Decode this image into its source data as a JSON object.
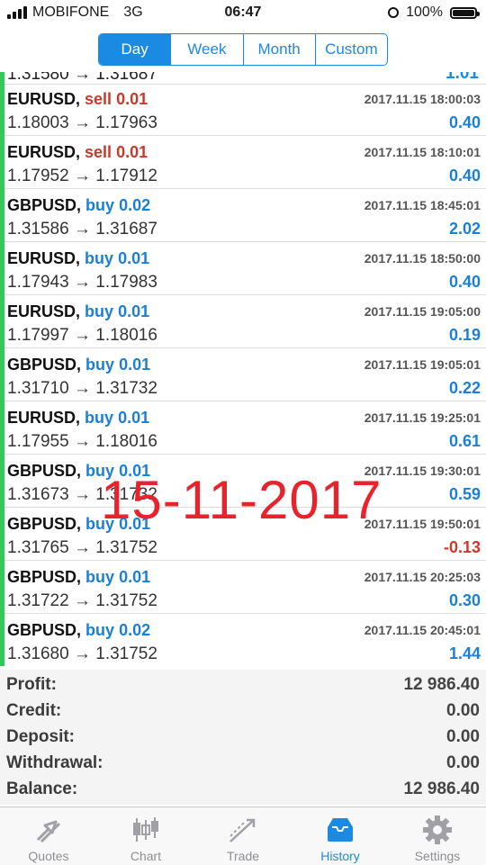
{
  "status_bar": {
    "carrier": "MOBIFONE",
    "network": "3G",
    "time": "06:47",
    "battery": "100%"
  },
  "period_tabs": [
    {
      "label": "Day",
      "active": true
    },
    {
      "label": "Week",
      "active": false
    },
    {
      "label": "Month",
      "active": false
    },
    {
      "label": "Custom",
      "active": false
    }
  ],
  "partial_row": {
    "left": "1.31580 → 1.31687",
    "right": "1.01"
  },
  "trades": [
    {
      "symbol": "EURUSD,",
      "side": "sell",
      "volume": "0.01",
      "time": "2017.11.15 18:00:03",
      "open": "1.18003",
      "close": "1.17963",
      "profit": "0.40"
    },
    {
      "symbol": "EURUSD,",
      "side": "sell",
      "volume": "0.01",
      "time": "2017.11.15 18:10:01",
      "open": "1.17952",
      "close": "1.17912",
      "profit": "0.40"
    },
    {
      "symbol": "GBPUSD,",
      "side": "buy",
      "volume": "0.02",
      "time": "2017.11.15 18:45:01",
      "open": "1.31586",
      "close": "1.31687",
      "profit": "2.02"
    },
    {
      "symbol": "EURUSD,",
      "side": "buy",
      "volume": "0.01",
      "time": "2017.11.15 18:50:00",
      "open": "1.17943",
      "close": "1.17983",
      "profit": "0.40"
    },
    {
      "symbol": "EURUSD,",
      "side": "buy",
      "volume": "0.01",
      "time": "2017.11.15 19:05:00",
      "open": "1.17997",
      "close": "1.18016",
      "profit": "0.19"
    },
    {
      "symbol": "GBPUSD,",
      "side": "buy",
      "volume": "0.01",
      "time": "2017.11.15 19:05:01",
      "open": "1.31710",
      "close": "1.31732",
      "profit": "0.22"
    },
    {
      "symbol": "EURUSD,",
      "side": "buy",
      "volume": "0.01",
      "time": "2017.11.15 19:25:01",
      "open": "1.17955",
      "close": "1.18016",
      "profit": "0.61"
    },
    {
      "symbol": "GBPUSD,",
      "side": "buy",
      "volume": "0.01",
      "time": "2017.11.15 19:30:01",
      "open": "1.31673",
      "close": "1.31732",
      "profit": "0.59"
    },
    {
      "symbol": "GBPUSD,",
      "side": "buy",
      "volume": "0.01",
      "time": "2017.11.15 19:50:01",
      "open": "1.31765",
      "close": "1.31752",
      "profit": "-0.13"
    },
    {
      "symbol": "GBPUSD,",
      "side": "buy",
      "volume": "0.01",
      "time": "2017.11.15 20:25:03",
      "open": "1.31722",
      "close": "1.31752",
      "profit": "0.30"
    },
    {
      "symbol": "GBPUSD,",
      "side": "buy",
      "volume": "0.02",
      "time": "2017.11.15 20:45:01",
      "open": "1.31680",
      "close": "1.31752",
      "profit": "1.44"
    }
  ],
  "watermark": "15-11-2017",
  "summary": [
    {
      "label": "Profit:",
      "value": "12 986.40"
    },
    {
      "label": "Credit:",
      "value": "0.00"
    },
    {
      "label": "Deposit:",
      "value": "0.00"
    },
    {
      "label": "Withdrawal:",
      "value": "0.00"
    },
    {
      "label": "Balance:",
      "value": "12 986.40"
    }
  ],
  "tab_bar": [
    {
      "label": "Quotes",
      "icon": "quotes-icon",
      "active": false
    },
    {
      "label": "Chart",
      "icon": "chart-icon",
      "active": false
    },
    {
      "label": "Trade",
      "icon": "trade-icon",
      "active": false
    },
    {
      "label": "History",
      "icon": "history-icon",
      "active": true
    },
    {
      "label": "Settings",
      "icon": "settings-icon",
      "active": false
    }
  ],
  "colors": {
    "accent": "#1b8ae3",
    "sell": "#c83a2a",
    "buy": "#1b7fd6",
    "positive": "#1b7fd6",
    "negative": "#c83a2a",
    "watermark": "#e8232b",
    "status_stripe": "#34c759"
  }
}
